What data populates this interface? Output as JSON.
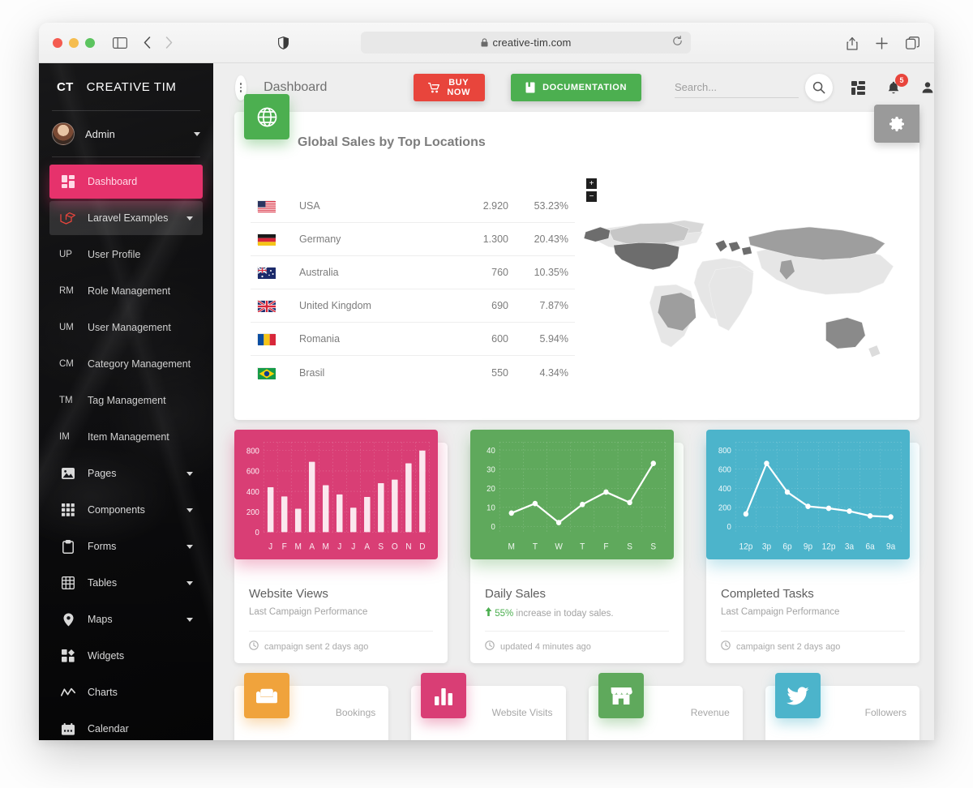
{
  "browser": {
    "url": "creative-tim.com",
    "lock_icon": "lock-icon",
    "reload_icon": "reload-icon",
    "sidebar_icon": "sidebar-toggle-icon",
    "back_icon": "chevron-left-icon",
    "forward_icon": "chevron-right-icon",
    "shield_icon": "shield-icon",
    "share_icon": "share-icon",
    "new_tab_icon": "plus-icon",
    "tabs_icon": "tab-overview-icon"
  },
  "sidebar": {
    "logo": "CT",
    "brand": "CREATIVE TIM",
    "user": "Admin",
    "items": [
      {
        "label": "Dashboard",
        "icon": "dashboard-icon",
        "state": "active",
        "caret": false
      },
      {
        "label": "Laravel Examples",
        "icon": "laravel-icon",
        "state": "open",
        "caret": true
      },
      {
        "label": "User Profile",
        "initials": "UP",
        "state": "sub",
        "caret": false
      },
      {
        "label": "Role Management",
        "initials": "RM",
        "state": "sub",
        "caret": false
      },
      {
        "label": "User Management",
        "initials": "UM",
        "state": "sub",
        "caret": false
      },
      {
        "label": "Category Management",
        "initials": "CM",
        "state": "sub",
        "caret": false
      },
      {
        "label": "Tag Management",
        "initials": "TM",
        "state": "sub",
        "caret": false
      },
      {
        "label": "Item Management",
        "initials": "IM",
        "state": "sub",
        "caret": false
      },
      {
        "label": "Pages",
        "icon": "image-icon",
        "state": "normal",
        "caret": true
      },
      {
        "label": "Components",
        "icon": "grid-icon",
        "state": "normal",
        "caret": true
      },
      {
        "label": "Forms",
        "icon": "clipboard-icon",
        "state": "normal",
        "caret": true
      },
      {
        "label": "Tables",
        "icon": "table-icon",
        "state": "normal",
        "caret": true
      },
      {
        "label": "Maps",
        "icon": "map-pin-icon",
        "state": "normal",
        "caret": true
      },
      {
        "label": "Widgets",
        "icon": "widgets-icon",
        "state": "normal",
        "caret": false
      },
      {
        "label": "Charts",
        "icon": "chart-line-icon",
        "state": "normal",
        "caret": false
      },
      {
        "label": "Calendar",
        "icon": "calendar-icon",
        "state": "normal",
        "caret": false
      }
    ]
  },
  "topbar": {
    "page_title": "Dashboard",
    "kebab_icon": "kebab-menu-icon",
    "buy_now_label": "BUY NOW",
    "buy_now_icon": "cart-icon",
    "buy_now_color": "#e8453c",
    "documentation_label": "DOCUMENTATION",
    "documentation_icon": "book-icon",
    "documentation_color": "#4caf50",
    "search_placeholder": "Search...",
    "search_value": "",
    "search_icon": "search-icon",
    "apps_icon": "apps-grid-icon",
    "notifications_icon": "bell-icon",
    "notifications_count": "5",
    "notifications_badge_color": "#e8453c",
    "account_icon": "person-icon"
  },
  "global_sales": {
    "title": "Global Sales by Top Locations",
    "badge_icon": "globe-icon",
    "badge_color": "#4caf50",
    "settings_icon": "gear-icon",
    "zoom_in": "+",
    "zoom_out": "−",
    "rows": [
      {
        "flag": "us",
        "country": "USA",
        "value": "2.920",
        "percent": "53.23%"
      },
      {
        "flag": "de",
        "country": "Germany",
        "value": "1.300",
        "percent": "20.43%"
      },
      {
        "flag": "au",
        "country": "Australia",
        "value": "760",
        "percent": "10.35%"
      },
      {
        "flag": "gb",
        "country": "United Kingdom",
        "value": "690",
        "percent": "7.87%"
      },
      {
        "flag": "ro",
        "country": "Romania",
        "value": "600",
        "percent": "5.94%"
      },
      {
        "flag": "br",
        "country": "Brasil",
        "value": "550",
        "percent": "4.34%"
      }
    ]
  },
  "chart_data": [
    {
      "type": "bar",
      "title": "Website Views",
      "subtitle": "Last Campaign Performance",
      "footer": "campaign sent 2 days ago",
      "footer_icon": "clock-icon",
      "color": "#d93e75",
      "categories": [
        "J",
        "F",
        "M",
        "A",
        "M",
        "J",
        "J",
        "A",
        "S",
        "O",
        "N",
        "D"
      ],
      "values": [
        440,
        350,
        230,
        690,
        460,
        370,
        240,
        345,
        480,
        515,
        675,
        800
      ],
      "yticks": [
        0,
        200,
        400,
        600,
        800
      ],
      "ylim": [
        0,
        880
      ],
      "xlabel": "",
      "ylabel": "",
      "grid": true,
      "legend": "none"
    },
    {
      "type": "line",
      "title": "Daily Sales",
      "subtitle_prefix": "55%",
      "subtitle_suffix": " increase in today sales.",
      "subtitle_icon": "arrow-up-icon",
      "footer": "updated 4 minutes ago",
      "footer_icon": "clock-icon",
      "color": "#5fa95c",
      "categories": [
        "M",
        "T",
        "W",
        "T",
        "F",
        "S",
        "S"
      ],
      "values": [
        7,
        12,
        2,
        11.5,
        18,
        12.5,
        33
      ],
      "yticks": [
        0,
        10,
        20,
        30,
        40
      ],
      "ylim": [
        -3,
        44
      ],
      "xlabel": "",
      "ylabel": "",
      "grid": true,
      "legend": "none"
    },
    {
      "type": "line",
      "title": "Completed Tasks",
      "subtitle": "Last Campaign Performance",
      "footer": "campaign sent 2 days ago",
      "footer_icon": "clock-icon",
      "color": "#4cb4cb",
      "categories": [
        "12p",
        "3p",
        "6p",
        "9p",
        "12p",
        "3a",
        "6a",
        "9a"
      ],
      "values": [
        130,
        660,
        360,
        210,
        190,
        160,
        110,
        100
      ],
      "yticks": [
        0,
        200,
        400,
        600,
        800
      ],
      "ylim": [
        -60,
        880
      ],
      "xlabel": "",
      "ylabel": "",
      "grid": true,
      "legend": "none"
    }
  ],
  "stats": [
    {
      "label": "Bookings",
      "icon": "sofa-icon",
      "color": "#f0a33c"
    },
    {
      "label": "Website Visits",
      "icon": "bar-icon",
      "color": "#d93e75"
    },
    {
      "label": "Revenue",
      "icon": "store-icon",
      "color": "#5fa95c"
    },
    {
      "label": "Followers",
      "icon": "twitter-icon",
      "color": "#4cb4cb"
    }
  ]
}
